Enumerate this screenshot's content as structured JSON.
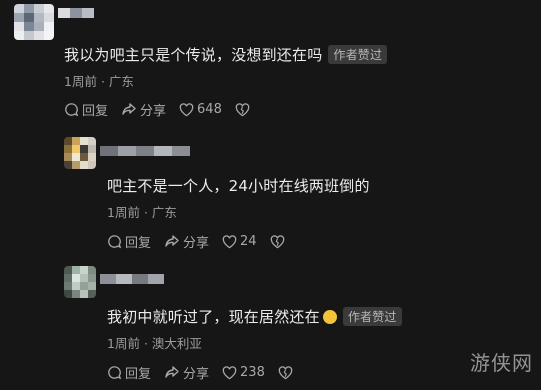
{
  "comments": [
    {
      "text": "我以为吧主只是个传说，没想到还在吗",
      "badge": "作者赞过",
      "time": "1周前",
      "location": "广东",
      "reply_label": "回复",
      "share_label": "分享",
      "likes": "648"
    },
    {
      "text": "吧主不是一个人，24小时在线两班倒的",
      "badge": "",
      "time": "1周前",
      "location": "广东",
      "reply_label": "回复",
      "share_label": "分享",
      "likes": "24"
    },
    {
      "text": "我初中就听过了，现在居然还在",
      "badge": "作者赞过",
      "time": "1周前",
      "location": "澳大利亚",
      "reply_label": "回复",
      "share_label": "分享",
      "likes": "238"
    }
  ],
  "meta_separator": "·",
  "watermark": "游侠网",
  "colors": {
    "background": "#161616",
    "text": "#ececec",
    "muted": "#9c9c9c",
    "badge_bg": "#3a3a3a"
  }
}
